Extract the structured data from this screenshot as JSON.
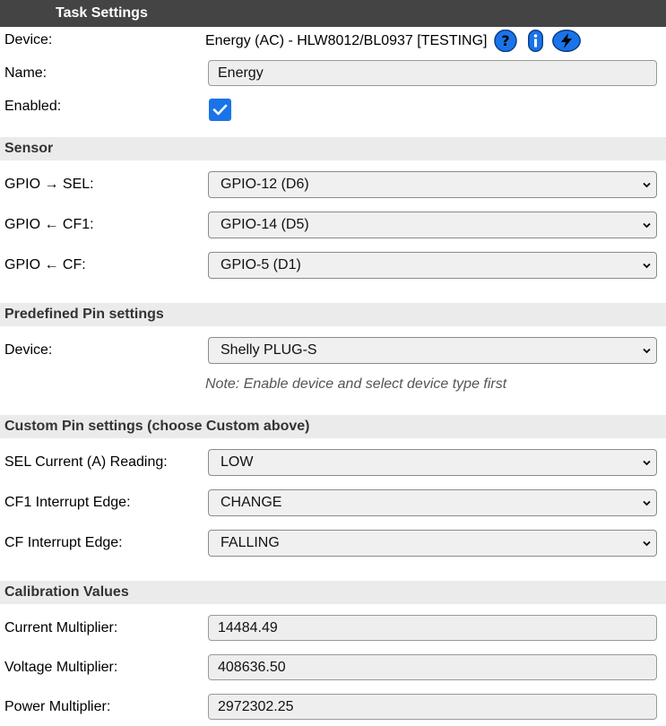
{
  "header": {
    "title": "Task Settings"
  },
  "device_row": {
    "label": "Device:",
    "value": "Energy (AC) - HLW8012/BL0937 [TESTING]",
    "icons": [
      "help-icon",
      "info-icon",
      "lightning-icon"
    ]
  },
  "name_row": {
    "label": "Name:",
    "value": "Energy"
  },
  "enabled_row": {
    "label": "Enabled:",
    "checked": true
  },
  "sensor": {
    "title": "Sensor",
    "rows": [
      {
        "label": "GPIO → SEL:",
        "value": "GPIO-12 (D6)"
      },
      {
        "label": "GPIO ← CF1:",
        "value": "GPIO-14 (D5)"
      },
      {
        "label": "GPIO ← CF:",
        "value": "GPIO-5 (D1)"
      }
    ]
  },
  "predefined": {
    "title": "Predefined Pin settings",
    "device_label": "Device:",
    "device_value": "Shelly PLUG-S",
    "note": "Note: Enable device and select device type first"
  },
  "custom": {
    "title": "Custom Pin settings (choose Custom above)",
    "rows": [
      {
        "label": "SEL Current (A) Reading:",
        "value": "LOW"
      },
      {
        "label": "CF1 Interrupt Edge:",
        "value": "CHANGE"
      },
      {
        "label": "CF Interrupt Edge:",
        "value": "FALLING"
      }
    ]
  },
  "calibration": {
    "title": "Calibration Values",
    "rows": [
      {
        "label": "Current Multiplier:",
        "value": "14484.49"
      },
      {
        "label": "Voltage Multiplier:",
        "value": "408636.50"
      },
      {
        "label": "Power Multiplier:",
        "value": "2972302.25"
      }
    ]
  },
  "colors": {
    "header_bg": "#444444",
    "section_bg": "#ebebeb",
    "accent": "#1a73e8"
  }
}
